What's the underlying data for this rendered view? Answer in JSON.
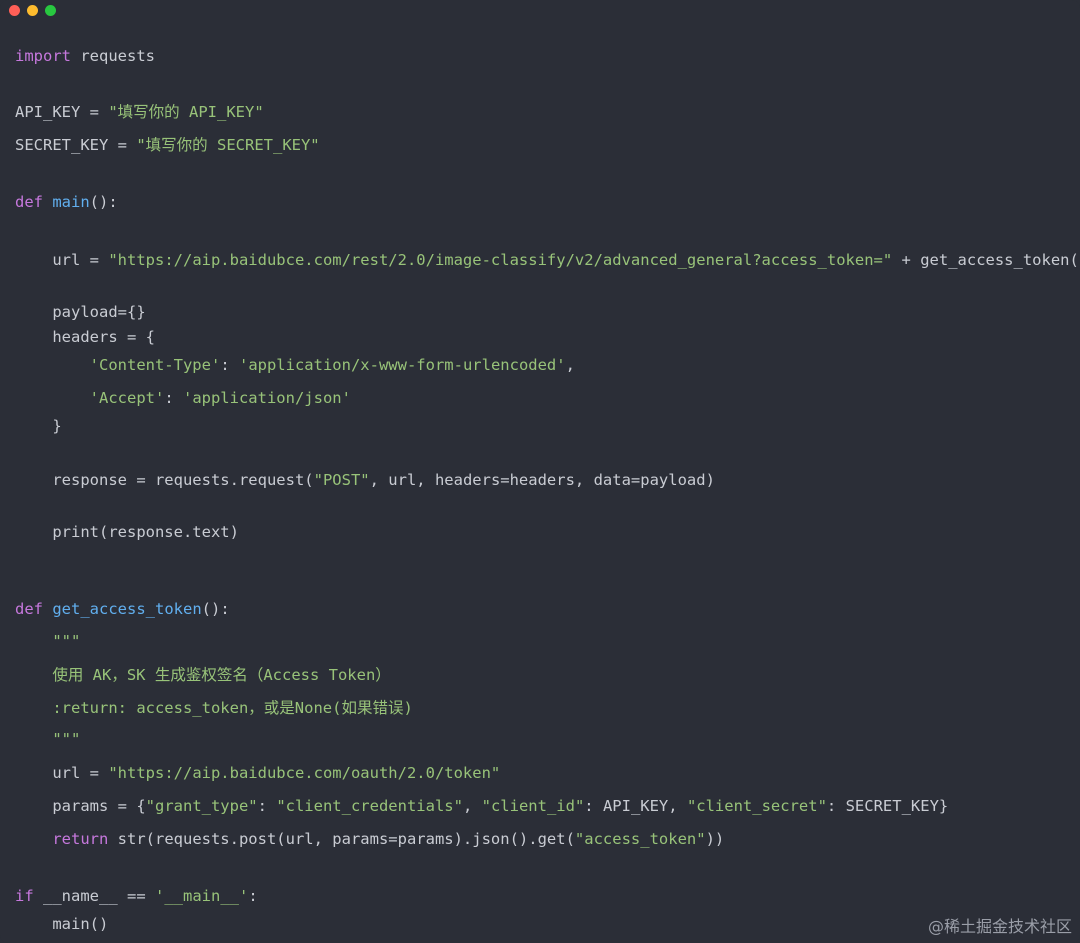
{
  "window": {
    "colors": {
      "background": "#2b2e37",
      "close": "#ff5f57",
      "minimize": "#febc2e",
      "zoom": "#28c840",
      "keyword": "#c678dd",
      "function": "#61afef",
      "string": "#98c379",
      "text": "#c9ccd3"
    }
  },
  "code": {
    "lines": [
      {
        "tokens": [
          {
            "t": "kw",
            "v": "import"
          },
          {
            "t": "plain",
            "v": " requests"
          }
        ]
      },
      {
        "tokens": [
          {
            "t": "plain",
            "v": "API_KEY = "
          },
          {
            "t": "str",
            "v": "\"填写你的 API_KEY\""
          }
        ]
      },
      {
        "tokens": [
          {
            "t": "plain",
            "v": "SECRET_KEY = "
          },
          {
            "t": "str",
            "v": "\"填写你的 SECRET_KEY\""
          }
        ]
      },
      {
        "tokens": [
          {
            "t": "kw",
            "v": "def"
          },
          {
            "t": "plain",
            "v": " "
          },
          {
            "t": "fn",
            "v": "main"
          },
          {
            "t": "plain",
            "v": "():"
          }
        ]
      },
      {
        "tokens": [
          {
            "t": "plain",
            "v": "    url = "
          },
          {
            "t": "str",
            "v": "\"https://aip.baidubce.com/rest/2.0/image-classify/v2/advanced_general?access_token=\""
          },
          {
            "t": "plain",
            "v": " + get_access_token()"
          }
        ]
      },
      {
        "tokens": [
          {
            "t": "plain",
            "v": "    payload={}"
          }
        ]
      },
      {
        "tokens": [
          {
            "t": "plain",
            "v": "    headers = {"
          }
        ]
      },
      {
        "tokens": [
          {
            "t": "plain",
            "v": "        "
          },
          {
            "t": "str",
            "v": "'Content-Type'"
          },
          {
            "t": "plain",
            "v": ": "
          },
          {
            "t": "str",
            "v": "'application/x-www-form-urlencoded'"
          },
          {
            "t": "plain",
            "v": ","
          }
        ]
      },
      {
        "tokens": [
          {
            "t": "plain",
            "v": "        "
          },
          {
            "t": "str",
            "v": "'Accept'"
          },
          {
            "t": "plain",
            "v": ": "
          },
          {
            "t": "str",
            "v": "'application/json'"
          }
        ]
      },
      {
        "tokens": [
          {
            "t": "plain",
            "v": "    }"
          }
        ]
      },
      {
        "tokens": [
          {
            "t": "plain",
            "v": "    response = requests.request("
          },
          {
            "t": "str",
            "v": "\"POST\""
          },
          {
            "t": "plain",
            "v": ", url, headers=headers, data=payload)"
          }
        ]
      },
      {
        "tokens": [
          {
            "t": "plain",
            "v": "    print(response.text)"
          }
        ]
      },
      {
        "tokens": [
          {
            "t": "kw",
            "v": "def"
          },
          {
            "t": "plain",
            "v": " "
          },
          {
            "t": "fn",
            "v": "get_access_token"
          },
          {
            "t": "plain",
            "v": "():"
          }
        ]
      },
      {
        "tokens": [
          {
            "t": "str",
            "v": "    \"\"\""
          }
        ]
      },
      {
        "tokens": [
          {
            "t": "str",
            "v": "    使用 AK，SK 生成鉴权签名（Access Token）"
          }
        ]
      },
      {
        "tokens": [
          {
            "t": "str",
            "v": "    :return: access_token，或是None(如果错误)"
          }
        ]
      },
      {
        "tokens": [
          {
            "t": "str",
            "v": "    \"\"\""
          }
        ]
      },
      {
        "tokens": [
          {
            "t": "plain",
            "v": "    url = "
          },
          {
            "t": "str",
            "v": "\"https://aip.baidubce.com/oauth/2.0/token\""
          }
        ]
      },
      {
        "tokens": [
          {
            "t": "plain",
            "v": "    params = {"
          },
          {
            "t": "str",
            "v": "\"grant_type\""
          },
          {
            "t": "plain",
            "v": ": "
          },
          {
            "t": "str",
            "v": "\"client_credentials\""
          },
          {
            "t": "plain",
            "v": ", "
          },
          {
            "t": "str",
            "v": "\"client_id\""
          },
          {
            "t": "plain",
            "v": ": API_KEY, "
          },
          {
            "t": "str",
            "v": "\"client_secret\""
          },
          {
            "t": "plain",
            "v": ": SECRET_KEY}"
          }
        ]
      },
      {
        "tokens": [
          {
            "t": "plain",
            "v": "    "
          },
          {
            "t": "kw",
            "v": "return"
          },
          {
            "t": "plain",
            "v": " str(requests.post(url, params=params).json().get("
          },
          {
            "t": "str",
            "v": "\"access_token\""
          },
          {
            "t": "plain",
            "v": "))"
          }
        ]
      },
      {
        "tokens": [
          {
            "t": "kw",
            "v": "if"
          },
          {
            "t": "plain",
            "v": " __name__ == "
          },
          {
            "t": "str",
            "v": "'__main__'"
          },
          {
            "t": "plain",
            "v": ":"
          }
        ]
      },
      {
        "tokens": [
          {
            "t": "plain",
            "v": "    main()"
          }
        ]
      }
    ]
  },
  "watermark": "@稀土掘金技术社区"
}
